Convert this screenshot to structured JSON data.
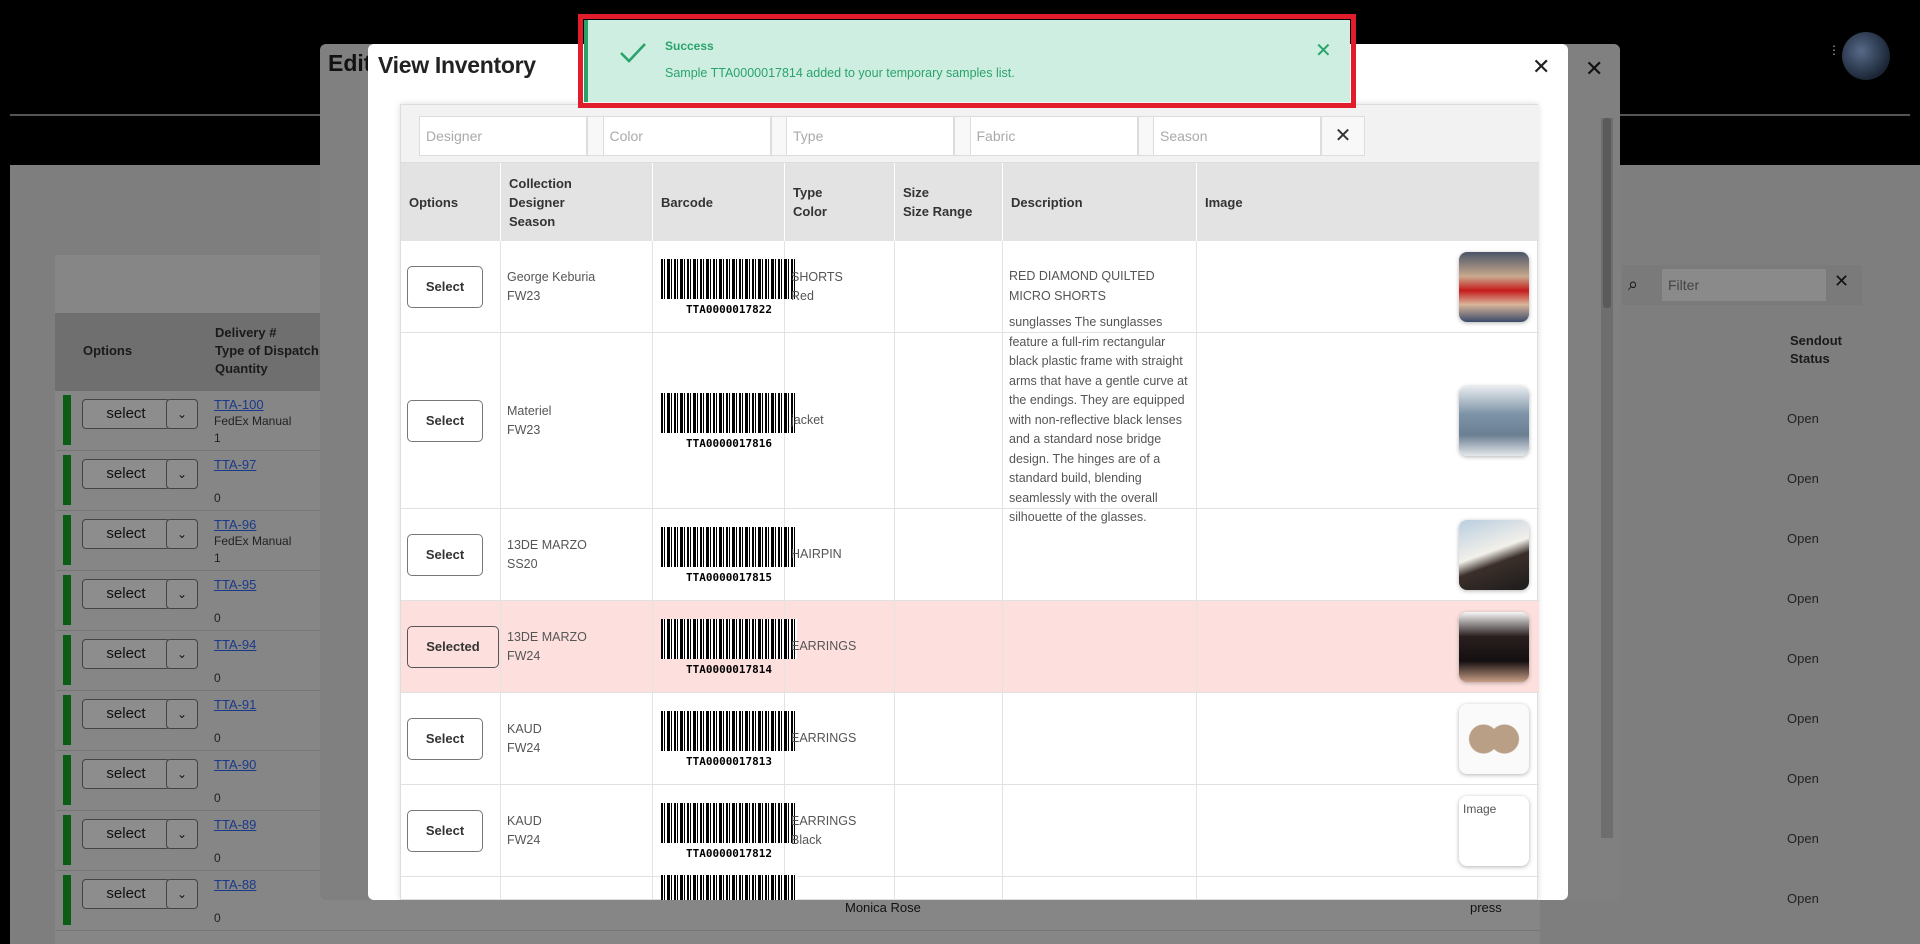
{
  "toast": {
    "title": "Success",
    "message": "Sample TTA0000017814 added to your temporary samples list.",
    "color": "#29a36a"
  },
  "edit_modal": {
    "title_fragment": "Edit"
  },
  "background_table": {
    "headers": {
      "options": "Options",
      "delivery": "Delivery #",
      "dispatch": "Type of Dispatch",
      "quantity": "Quantity",
      "sendout": "Sendout",
      "status": "Status"
    },
    "filter_placeholder": "Filter",
    "select_label": "select",
    "rows": [
      {
        "link": "TTA-100",
        "dispatch": "FedEx Manual",
        "qty": "1",
        "status": "Open"
      },
      {
        "link": "TTA-97",
        "dispatch": "",
        "qty": "0",
        "status": "Open"
      },
      {
        "link": "TTA-96",
        "dispatch": "FedEx Manual",
        "qty": "1",
        "status": "Open"
      },
      {
        "link": "TTA-95",
        "dispatch": "",
        "qty": "0",
        "status": "Open"
      },
      {
        "link": "TTA-94",
        "dispatch": "",
        "qty": "0",
        "status": "Open"
      },
      {
        "link": "TTA-91",
        "dispatch": "",
        "qty": "0",
        "status": "Open"
      },
      {
        "link": "TTA-90",
        "dispatch": "",
        "qty": "0",
        "status": "Open"
      },
      {
        "link": "TTA-89",
        "dispatch": "",
        "qty": "0",
        "status": "Open"
      },
      {
        "link": "TTA-88",
        "dispatch": "",
        "qty": "0",
        "status": "Open"
      }
    ],
    "bottom_text_1": "Monica Rose",
    "bottom_text_2": "press"
  },
  "inventory": {
    "title": "View Inventory",
    "filters": [
      {
        "placeholder": "Designer"
      },
      {
        "placeholder": "Color"
      },
      {
        "placeholder": "Type"
      },
      {
        "placeholder": "Fabric"
      },
      {
        "placeholder": "Season"
      }
    ],
    "headers": {
      "options": "Options",
      "collection": "Collection",
      "designer": "Designer",
      "season": "Season",
      "barcode": "Barcode",
      "type": "Type",
      "color": "Color",
      "size": "Size",
      "size_range": "Size Range",
      "description": "Description",
      "image": "Image"
    },
    "rows": [
      {
        "button": "Select",
        "designer": "George Keburia",
        "season": "FW23",
        "barcode": "TTA0000017822",
        "type": "SHORTS",
        "color": "Red",
        "description": "RED DIAMOND QUILTED MICRO SHORTS",
        "image": "photo-red-shorts",
        "selected": false
      },
      {
        "button": "Select",
        "designer": "Materiel",
        "season": "FW23",
        "barcode": "TTA0000017816",
        "type": "jacket",
        "color": "",
        "description": "sunglasses The sunglasses feature a full-rim rectangular black plastic frame with straight arms that have a gentle curve at the endings. They are equipped with non-reflective black lenses and a standard nose bridge design. The hinges are of a standard build, blending seamlessly with the overall silhouette of the glasses.",
        "image": "photo-jacket",
        "selected": false
      },
      {
        "button": "Select",
        "designer": "13DE MARZO",
        "season": "SS20",
        "barcode": "TTA0000017815",
        "type": "HAIRPIN",
        "color": "",
        "description": "",
        "image": "photo-hairpin",
        "selected": false
      },
      {
        "button": "Selected",
        "designer": "13DE MARZO",
        "season": "FW24",
        "barcode": "TTA0000017814",
        "type": "EARRINGS",
        "color": "",
        "description": "",
        "image": "photo-earrings",
        "selected": true
      },
      {
        "button": "Select",
        "designer": "KAUD",
        "season": "FW24",
        "barcode": "TTA0000017813",
        "type": "EARRINGS",
        "color": "",
        "description": "",
        "image": "photo-bra-earrings",
        "selected": false
      },
      {
        "button": "Select",
        "designer": "KAUD",
        "season": "FW24",
        "barcode": "TTA0000017812",
        "type": "EARRINGS",
        "color": "Black",
        "description": "",
        "image": "broken-image",
        "broken_alt": "Image",
        "selected": false
      }
    ]
  }
}
